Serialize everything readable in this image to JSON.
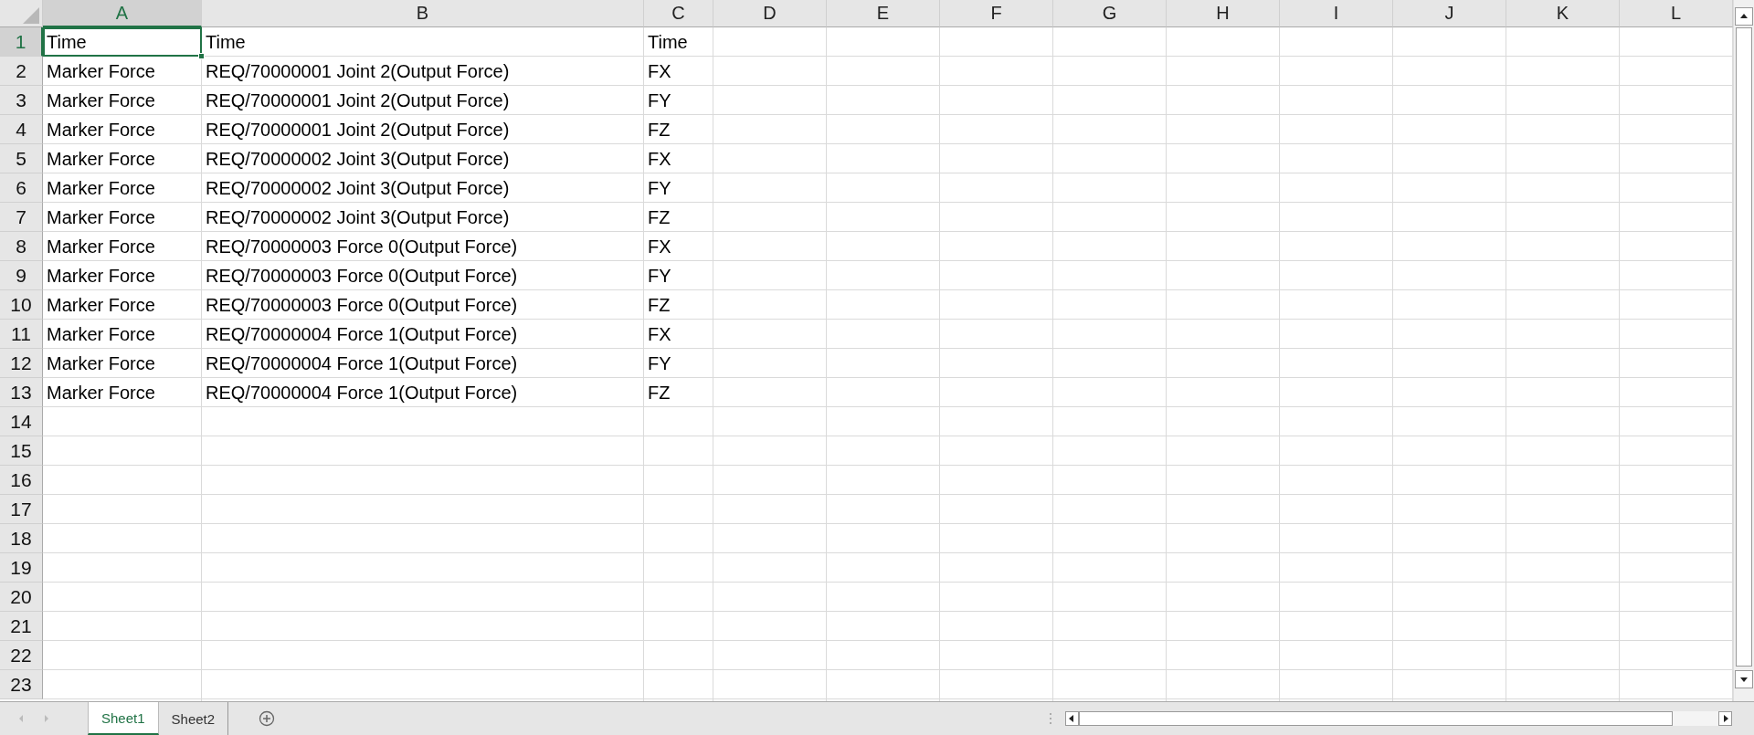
{
  "columns": [
    {
      "label": "A",
      "selected": true
    },
    {
      "label": "B",
      "selected": false
    },
    {
      "label": "C",
      "selected": false
    },
    {
      "label": "D",
      "selected": false
    },
    {
      "label": "E",
      "selected": false
    },
    {
      "label": "F",
      "selected": false
    },
    {
      "label": "G",
      "selected": false
    },
    {
      "label": "H",
      "selected": false
    },
    {
      "label": "I",
      "selected": false
    },
    {
      "label": "J",
      "selected": false
    },
    {
      "label": "K",
      "selected": false
    },
    {
      "label": "L",
      "selected": false
    }
  ],
  "rows": [
    {
      "header": "1",
      "selected": true,
      "cells": [
        {
          "text": "Time",
          "selected": true
        },
        {
          "text": "Time",
          "selected": false
        },
        {
          "text": "Time",
          "selected": false
        }
      ]
    },
    {
      "header": "2",
      "selected": false,
      "cells": [
        {
          "text": "Marker Force",
          "selected": false
        },
        {
          "text": "REQ/70000001 Joint 2(Output Force)",
          "selected": false
        },
        {
          "text": "FX",
          "selected": false
        }
      ]
    },
    {
      "header": "3",
      "selected": false,
      "cells": [
        {
          "text": "Marker Force",
          "selected": false
        },
        {
          "text": "REQ/70000001 Joint 2(Output Force)",
          "selected": false
        },
        {
          "text": "FY",
          "selected": false
        }
      ]
    },
    {
      "header": "4",
      "selected": false,
      "cells": [
        {
          "text": "Marker Force",
          "selected": false
        },
        {
          "text": "REQ/70000001 Joint 2(Output Force)",
          "selected": false
        },
        {
          "text": "FZ",
          "selected": false
        }
      ]
    },
    {
      "header": "5",
      "selected": false,
      "cells": [
        {
          "text": "Marker Force",
          "selected": false
        },
        {
          "text": "REQ/70000002 Joint 3(Output Force)",
          "selected": false
        },
        {
          "text": "FX",
          "selected": false
        }
      ]
    },
    {
      "header": "6",
      "selected": false,
      "cells": [
        {
          "text": "Marker Force",
          "selected": false
        },
        {
          "text": "REQ/70000002 Joint 3(Output Force)",
          "selected": false
        },
        {
          "text": "FY",
          "selected": false
        }
      ]
    },
    {
      "header": "7",
      "selected": false,
      "cells": [
        {
          "text": "Marker Force",
          "selected": false
        },
        {
          "text": "REQ/70000002 Joint 3(Output Force)",
          "selected": false
        },
        {
          "text": "FZ",
          "selected": false
        }
      ]
    },
    {
      "header": "8",
      "selected": false,
      "cells": [
        {
          "text": "Marker Force",
          "selected": false
        },
        {
          "text": "REQ/70000003 Force 0(Output Force)",
          "selected": false
        },
        {
          "text": "FX",
          "selected": false
        }
      ]
    },
    {
      "header": "9",
      "selected": false,
      "cells": [
        {
          "text": "Marker Force",
          "selected": false
        },
        {
          "text": "REQ/70000003 Force 0(Output Force)",
          "selected": false
        },
        {
          "text": "FY",
          "selected": false
        }
      ]
    },
    {
      "header": "10",
      "selected": false,
      "cells": [
        {
          "text": "Marker Force",
          "selected": false
        },
        {
          "text": "REQ/70000003 Force 0(Output Force)",
          "selected": false
        },
        {
          "text": "FZ",
          "selected": false
        }
      ]
    },
    {
      "header": "11",
      "selected": false,
      "cells": [
        {
          "text": "Marker Force",
          "selected": false
        },
        {
          "text": "REQ/70000004 Force 1(Output Force)",
          "selected": false
        },
        {
          "text": "FX",
          "selected": false
        }
      ]
    },
    {
      "header": "12",
      "selected": false,
      "cells": [
        {
          "text": "Marker Force",
          "selected": false
        },
        {
          "text": "REQ/70000004 Force 1(Output Force)",
          "selected": false
        },
        {
          "text": "FY",
          "selected": false
        }
      ]
    },
    {
      "header": "13",
      "selected": false,
      "cells": [
        {
          "text": "Marker Force",
          "selected": false
        },
        {
          "text": "REQ/70000004 Force 1(Output Force)",
          "selected": false
        },
        {
          "text": "FZ",
          "selected": false
        }
      ]
    },
    {
      "header": "14",
      "selected": false,
      "cells": []
    },
    {
      "header": "15",
      "selected": false,
      "cells": []
    },
    {
      "header": "16",
      "selected": false,
      "cells": []
    },
    {
      "header": "17",
      "selected": false,
      "cells": []
    },
    {
      "header": "18",
      "selected": false,
      "cells": []
    },
    {
      "header": "19",
      "selected": false,
      "cells": []
    },
    {
      "header": "20",
      "selected": false,
      "cells": []
    },
    {
      "header": "21",
      "selected": false,
      "cells": []
    },
    {
      "header": "22",
      "selected": false,
      "cells": []
    },
    {
      "header": "23",
      "selected": false,
      "cells": []
    }
  ],
  "sheet_tabs": [
    {
      "label": "Sheet1",
      "selected": true
    },
    {
      "label": "Sheet2",
      "selected": false
    }
  ]
}
